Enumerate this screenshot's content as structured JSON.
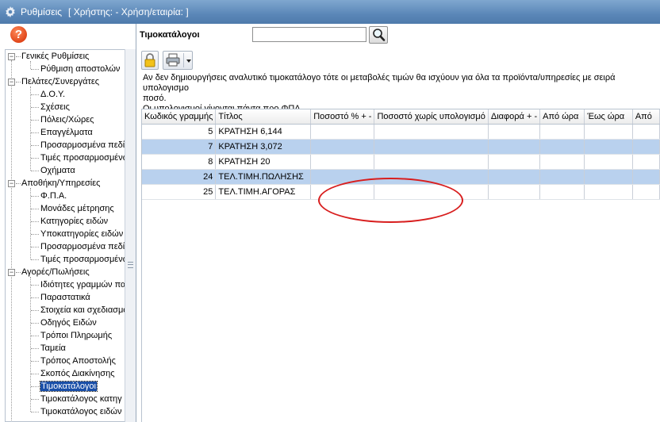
{
  "window": {
    "title": "Ρυθμίσεις",
    "subtitle": "[ Χρήστης: - Χρήση/εταιρία: ]"
  },
  "help": {
    "label": "?"
  },
  "tree": {
    "sections": [
      {
        "label": "Γενικές Ρυθμίσεις",
        "items": [
          "Ρύθμιση αποστολών"
        ]
      },
      {
        "label": "Πελάτες/Συνεργάτες",
        "items": [
          "Δ.Ο.Υ.",
          "Σχέσεις",
          "Πόλεις/Χώρες",
          "Επαγγέλματα",
          "Προσαρμοσμένα πεδί",
          "Τιμές προσαρμοσμένω",
          "Οχήματα"
        ]
      },
      {
        "label": "Αποθήκη/Υπηρεσίες",
        "items": [
          "Φ.Π.Α.",
          "Μονάδες μέτρησης",
          "Κατηγορίες ειδών",
          "Υποκατηγορίες ειδών",
          "Προσαρμοσμένα πεδί",
          "Τιμές προσαρμοσμένω"
        ]
      },
      {
        "label": "Αγορές/Πωλήσεις",
        "items": [
          "Ιδιότητες γραμμών πα",
          "Παραστατικά",
          "Στοιχεία και σχεδιασμό",
          "Οδηγός Ειδών",
          "Τρόποι Πληρωμής",
          "Ταμεία",
          "Τρόπος Αποστολής",
          "Σκοπός Διακίνησης",
          "Τιμοκατάλογοι",
          "Τιμοκατάλογος κατηγ",
          "Τιμοκατάλογος ειδών"
        ]
      }
    ],
    "selected": "Τιμοκατάλογοι"
  },
  "search": {
    "label": "Τιμοκατάλογοι",
    "value": "",
    "placeholder": ""
  },
  "info": {
    "line1": "Αν δεν δημιουργήσεις αναλυτικό τιμοκατάλογο τότε οι μεταβολές τιμών θα ισχύουν για όλα τα προϊόντα/υπηρεσίες με σειρά υπολογισμο",
    "line2": "ποσό.",
    "line3": "Οι υπολογισμοί γίνονται πάντα προ ΦΠΑ."
  },
  "table": {
    "columns": [
      "Κωδικός γραμμής",
      "Τίτλος",
      "Ποσοστό % + -",
      "Ποσοστό χωρίς υπολογισμό",
      "Διαφορά + -",
      "Από ώρα",
      "Έως ώρα",
      "Από"
    ],
    "rows": [
      [
        "5",
        "ΚΡΑΤΗΣΗ 6,144"
      ],
      [
        "7",
        "ΚΡΑΤΗΣΗ 3,072"
      ],
      [
        "8",
        "ΚΡΑΤΗΣΗ 20"
      ],
      [
        "24",
        "ΤΕΛ.ΤΙΜΗ.ΠΩΛΗΣΗΣ"
      ],
      [
        "25",
        "ΤΕΛ.ΤΙΜΗ.ΑΓΟΡΑΣ"
      ]
    ]
  },
  "colors": {
    "accent": "#5b87b8",
    "row_highlight": "#b9d1ee",
    "selection": "#1a4fa8",
    "annotation": "#d81e1e"
  },
  "icons": {
    "title": "gear-icon",
    "help": "help-icon",
    "search": "magnifier-icon",
    "lock": "lock-icon",
    "print": "printer-icon"
  }
}
